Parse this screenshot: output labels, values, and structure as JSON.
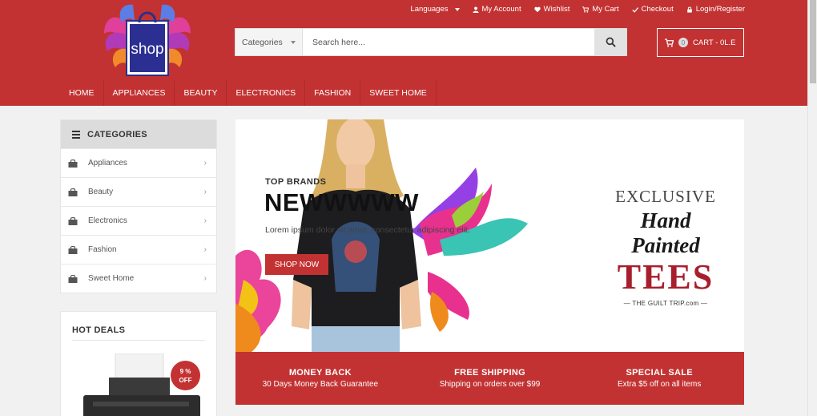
{
  "colors": {
    "brand_red": "#c33232",
    "banner_red": "#a81e2d",
    "panel_grey": "#dcdcdc"
  },
  "logo": {
    "text": "shop"
  },
  "top_links": [
    {
      "label": "Languages",
      "icon": ""
    },
    {
      "label": "My Account",
      "icon": "user-icon"
    },
    {
      "label": "Wishlist",
      "icon": "heart-icon"
    },
    {
      "label": "My Cart",
      "icon": "cart-icon"
    },
    {
      "label": "Checkout",
      "icon": "check-icon"
    },
    {
      "label": "Login/Register",
      "icon": "lock-icon"
    }
  ],
  "search": {
    "category_label": "Categories",
    "placeholder": "Search here..."
  },
  "cart": {
    "count": "0",
    "label": "CART - 0L.E"
  },
  "nav": [
    "HOME",
    "APPLIANCES",
    "BEAUTY",
    "ELECTRONICS",
    "FASHION",
    "SWEET HOME"
  ],
  "categories": {
    "title": "CATEGORIES",
    "items": [
      "Appliances",
      "Beauty",
      "Electronics",
      "Fashion",
      "Sweet Home"
    ]
  },
  "hot_deals": {
    "title": "HOT DEALS",
    "discount_value": "9 %",
    "discount_word": "OFF"
  },
  "banner": {
    "brand": "TOP BRANDS",
    "headline": "NEWWWWW",
    "subtitle": "Lorem ipsum dolor sit amet, consectetur adipiscing elit.",
    "button": "SHOP NOW",
    "ad_line1": "EXCLUSIVE",
    "ad_line2": "Hand Painted",
    "ad_line3": "TEES",
    "ad_line4": "— THE GUILT TRIP.com —"
  },
  "features": [
    {
      "title": "MONEY BACK",
      "desc": "30 Days Money Back Guarantee"
    },
    {
      "title": "FREE SHIPPING",
      "desc": "Shipping on orders over $99"
    },
    {
      "title": "SPECIAL SALE",
      "desc": "Extra $5 off on all items"
    }
  ]
}
